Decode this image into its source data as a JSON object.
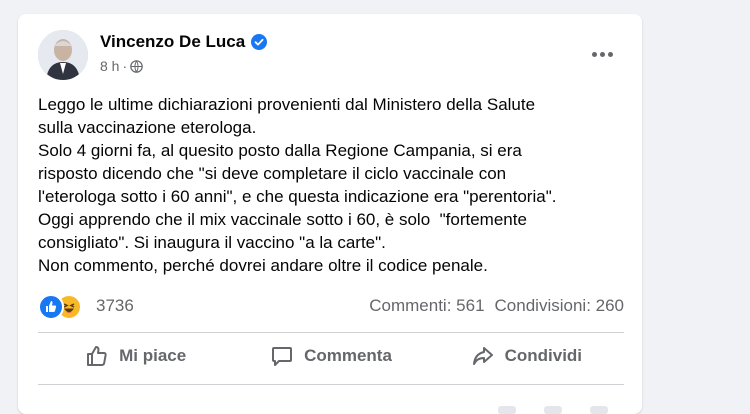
{
  "post": {
    "author": "Vincenzo De Luca",
    "time": "8 h",
    "meta_separator": "·",
    "text_lines": [
      "Leggo le ultime dichiarazioni provenienti dal Ministero della Salute",
      "sulla vaccinazione eterologa.",
      "Solo 4 giorni fa, al quesito posto dalla Regione Campania, si era",
      "risposto dicendo che \"si deve completare il ciclo vaccinale con",
      "l'eterologa sotto i 60 anni\", e che questa indicazione era \"perentoria\".",
      "Oggi apprendo che il mix vaccinale sotto i 60, è solo  \"fortemente",
      "consigliato\". Si inaugura il vaccino \"a la carte\".",
      "Non commento, perché dovrei andare oltre il codice penale."
    ]
  },
  "stats": {
    "reaction_count": "3736",
    "comments": "Commenti: 561",
    "shares": "Condivisioni: 260"
  },
  "actions": {
    "like": "Mi piace",
    "comment": "Commenta",
    "share": "Condividi"
  },
  "icons": {
    "verified": "verified-badge-icon",
    "privacy": "globe-icon",
    "more": "more-dots-icon",
    "reaction_like": "thumbs-up-icon",
    "reaction_haha": "laughing-face-icon"
  },
  "colors": {
    "brand_blue": "#1877f2",
    "text_primary": "#050505",
    "text_secondary": "#65676b",
    "haha_yellow": "#f7b928"
  }
}
